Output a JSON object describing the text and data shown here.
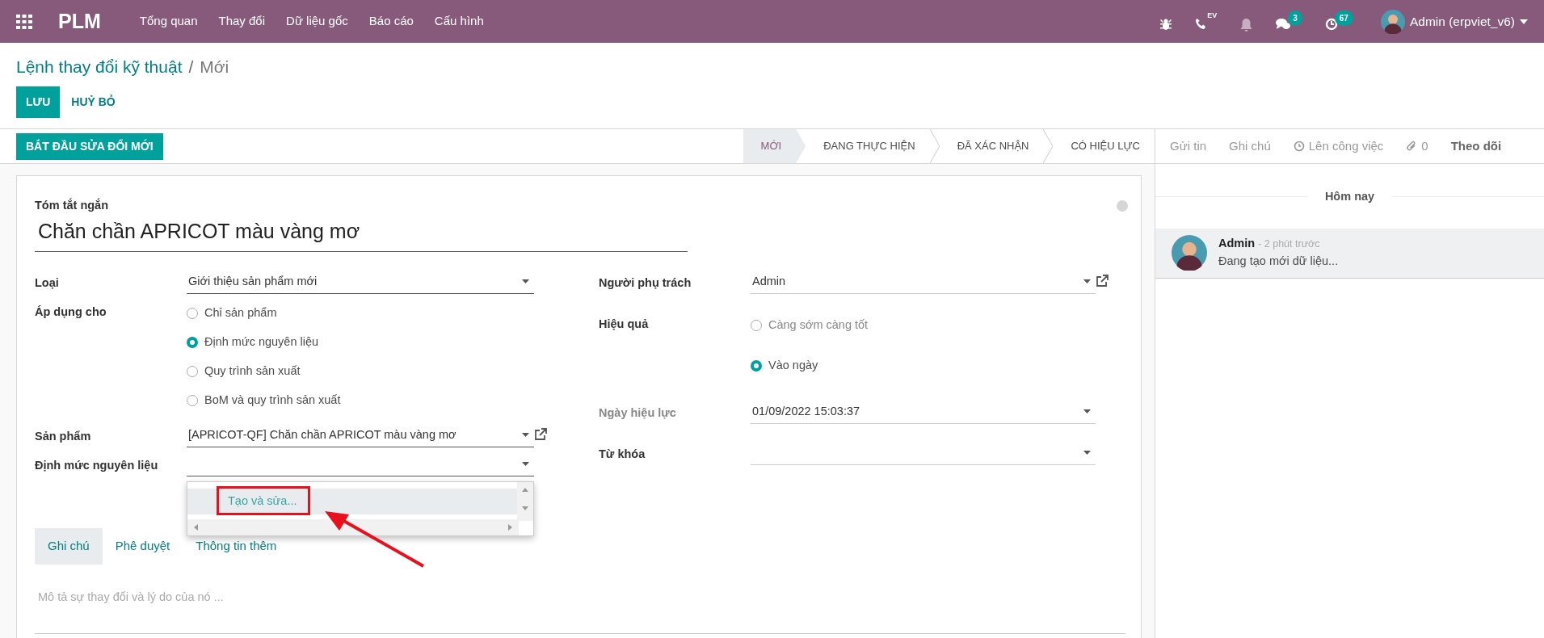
{
  "navbar": {
    "app_name": "PLM",
    "menu": [
      "Tổng quan",
      "Thay đổi",
      "Dữ liệu gốc",
      "Báo cáo",
      "Cấu hình"
    ],
    "systray": [
      {
        "kind": "bug"
      },
      {
        "kind": "phone",
        "label": "EV"
      },
      {
        "kind": "bell"
      },
      {
        "kind": "chat",
        "badge": "3"
      },
      {
        "kind": "activity",
        "badge": "67"
      }
    ],
    "user": "Admin (erpviet_v6)"
  },
  "breadcrumb": {
    "parent": "Lệnh thay đổi kỹ thuật",
    "separator": "/",
    "current": "Mới"
  },
  "buttons": {
    "save": "LƯU",
    "discard": "HUỶ BỎ"
  },
  "header_button": "BẮT ĐẦU SỬA ĐỔI MỚI",
  "stages": [
    {
      "label": "MỚI",
      "selected": true
    },
    {
      "label": "ĐANG THỰC HIỆN",
      "selected": false
    },
    {
      "label": "ĐÃ XÁC NHẬN",
      "selected": false
    },
    {
      "label": "CÓ HIỆU LỰC",
      "selected": false
    }
  ],
  "chatter_actions": [
    {
      "kind": "text",
      "label": "Gửi tin"
    },
    {
      "kind": "text",
      "label": "Ghi chú"
    },
    {
      "kind": "clock",
      "label": "Lên công việc"
    },
    {
      "kind": "attachment",
      "label": "0"
    },
    {
      "kind": "follow",
      "label": "Theo dõi"
    }
  ],
  "form": {
    "summary_label": "Tóm tắt ngắn",
    "summary_value": "Chăn chần APRICOT màu vàng mơ",
    "left_fields": [
      {
        "kind": "select",
        "label": "Loại",
        "value": "Giới thiệu sản phẩm mới",
        "required": true
      },
      {
        "kind": "radio",
        "label": "Áp dụng cho",
        "options": [
          {
            "label": "Chỉ sản phẩm",
            "selected": false
          },
          {
            "label": "Định mức nguyên liệu",
            "selected": true
          },
          {
            "label": "Quy trình sản xuất",
            "selected": false
          },
          {
            "label": "BoM và quy trình sản xuất",
            "selected": false
          }
        ]
      }
    ],
    "product_fields": [
      {
        "kind": "select",
        "label": "Sản phẩm",
        "value": "[APRICOT-QF] Chăn chần APRICOT màu vàng mơ",
        "required": true,
        "external_link": true
      },
      {
        "kind": "select",
        "label": "Định mức nguyên liệu",
        "required": true,
        "dropdown": [
          {
            "label": "Tạo và sửa...",
            "selected": true
          }
        ]
      }
    ],
    "right_fields": [
      {
        "kind": "select",
        "label": "Người phụ trách",
        "value": "Admin",
        "required": false,
        "external_link": true
      },
      {
        "kind": "radio",
        "label": "Hiệu quả",
        "options": [
          {
            "label": "Càng sớm càng tốt",
            "selected": false
          },
          {
            "label": "Vào ngày",
            "selected": true
          }
        ]
      },
      {
        "kind": "select",
        "label": "Ngày hiệu lực",
        "value": "01/09/2022 15:03:37",
        "required": false,
        "muted_label": true
      },
      {
        "kind": "select",
        "label": "Từ khóa",
        "required": false
      }
    ],
    "tabs": [
      {
        "label": "Ghi chú",
        "selected": true
      },
      {
        "label": "Phê duyệt",
        "selected": false
      },
      {
        "label": "Thông tin thêm",
        "selected": false
      }
    ],
    "note_placeholder": "Mô tả sự thay đổi và lý do của nó ..."
  },
  "annotation": {
    "highlight_box": true,
    "arrow": true
  },
  "chatter": {
    "date_separator": "Hôm nay",
    "messages": [
      {
        "author": "Admin",
        "time": "- 2 phút trước",
        "body": "Đang tạo mới dữ liệu..."
      }
    ]
  }
}
